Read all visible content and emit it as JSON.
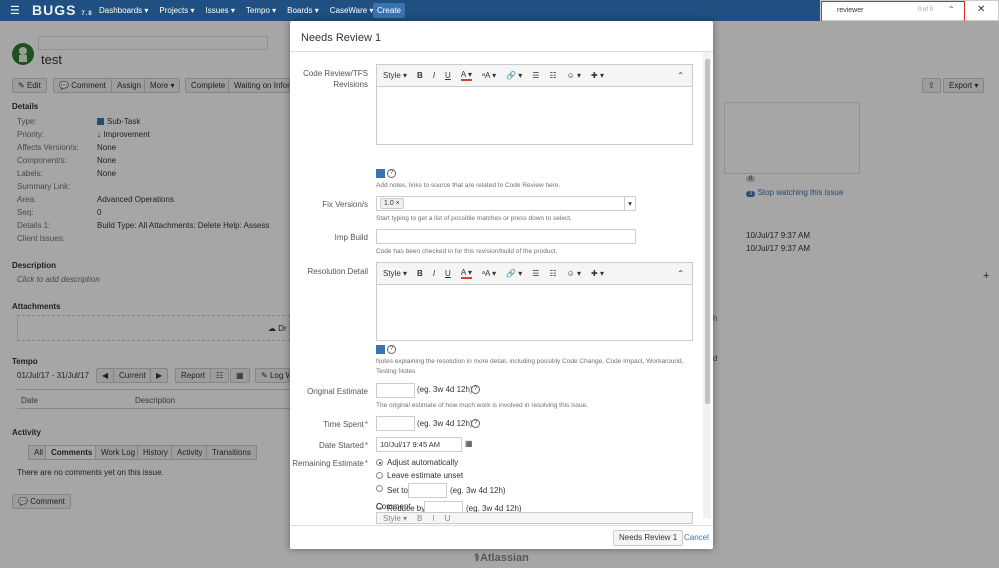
{
  "nav": {
    "logo": "BUGS",
    "logo_suffix": "7.8",
    "menus": [
      "Dashboards ▾",
      "Projects ▾",
      "Issues ▾",
      "Tempo ▾",
      "Boards ▾",
      "CaseWare ▾"
    ],
    "create": "Create"
  },
  "find": {
    "query": "reviewer",
    "count": "0 of 0"
  },
  "issue": {
    "title": "test",
    "actions": [
      "Edit",
      "Comment",
      "Assign",
      "More ▾",
      "Complete",
      "Waiting on Inform"
    ],
    "export": "Export ▾",
    "details_heading": "Details",
    "fields": [
      {
        "label": "Type:",
        "value": "Sub-Task"
      },
      {
        "label": "Priority:",
        "value": "Improvement"
      },
      {
        "label": "Affects Version/s:",
        "value": "None"
      },
      {
        "label": "Component/s:",
        "value": "None"
      },
      {
        "label": "Labels:",
        "value": "None"
      },
      {
        "label": "Summary Link:",
        "value": ""
      },
      {
        "label": "Area:",
        "value": "Advanced Operations"
      },
      {
        "label": "Seq:",
        "value": "0"
      },
      {
        "label": "Details 1:",
        "value": "Build Type: All Attachments: Delete Help: Assess"
      },
      {
        "label": "Client Issues:",
        "value": ""
      }
    ],
    "description_heading": "Description",
    "description_placeholder": "Click to add description",
    "attachments_heading": "Attachments",
    "attachments_drop": "Dr",
    "tempo_heading": "Tempo",
    "tempo_range": "01/Jul/17 - 31/Jul/17",
    "tempo_current": "Current",
    "tempo_report": "Report",
    "tempo_log": "Log W",
    "tempo_cols": [
      "Date",
      "Description"
    ],
    "activity_heading": "Activity",
    "activity_tabs": [
      "All",
      "Comments",
      "Work Log",
      "History",
      "Activity",
      "Transitions"
    ],
    "no_comments": "There are no comments yet on this issue.",
    "comment_button": "Comment",
    "watch_count": "0",
    "watchers_count": "3",
    "stop_watching": "Stop watching this issue",
    "dates": [
      "10/Jul/17 9:37 AM",
      "10/Jul/17 9:37 AM"
    ],
    "right_partial": [
      "h",
      "d"
    ]
  },
  "modal": {
    "title": "Needs Review 1",
    "editor_toolbar": [
      "Style ▾",
      "B",
      "I",
      "U",
      "A ▾",
      "ᵃA ▾",
      "🔗 ▾",
      "☰",
      "☷",
      "☺ ▾",
      "✚ ▾"
    ],
    "code_review_label": "Code Review/TFS Revisions",
    "code_review_help": "Add notes, links to source that are related to Code Review here.",
    "fix_version_label": "Fix Version/s",
    "fix_version_tag": "1.0",
    "fix_version_help": "Start typing to get a list of possible matches or press down to select.",
    "imp_build_label": "Imp Build",
    "imp_build_help": "Code has been checked in for this revision/build of the product.",
    "resolution_label": "Resolution Detail",
    "resolution_help": "Notes explaining the resolution in more detail, including possibly Code Change, Code Impact, Workaround, Testing Notes",
    "orig_estimate_label": "Original Estimate",
    "orig_estimate_hint": "(eg. 3w 4d 12h)",
    "orig_estimate_help": "The original estimate of how much work is involved in resolving this issue.",
    "time_spent_label": "Time Spent",
    "time_spent_hint": "(eg. 3w 4d 12h)",
    "date_started_label": "Date Started",
    "date_started_value": "10/Jul/17 9:45 AM",
    "remaining_label": "Remaining Estimate",
    "remaining_options": [
      "Adjust automatically",
      "Leave estimate unset",
      "Set to",
      "Reduce by"
    ],
    "set_to_hint": "(eg. 3w 4d 12h)",
    "reduce_by_hint": "(eg. 3w 4d 12h)",
    "comment_label": "Comment",
    "submit": "Needs Review 1",
    "cancel": "Cancel"
  },
  "footer": {
    "brand": "Atlassian"
  },
  "colors": {
    "nav": "#205081",
    "link": "#3b73af",
    "required": "#d04437",
    "find_highlight": "#d9262b"
  }
}
